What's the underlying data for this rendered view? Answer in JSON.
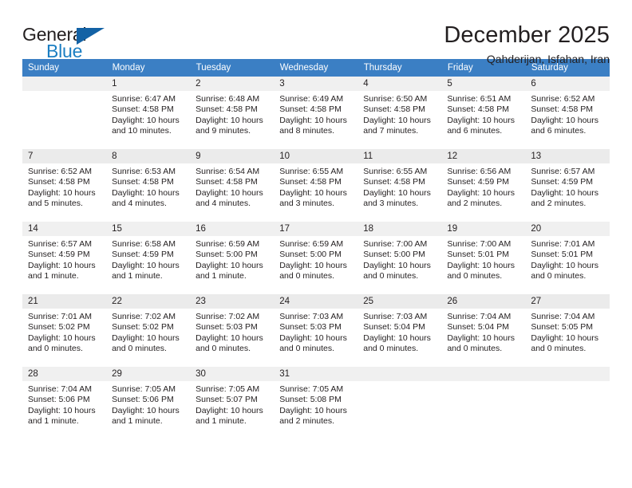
{
  "brand": {
    "general": "General",
    "blue": "Blue",
    "triangle_color": "#1362a5",
    "blue_color": "#1b7ec2"
  },
  "header": {
    "title": "December 2025",
    "subtitle": "Qahderijan, Isfahan, Iran"
  },
  "theme": {
    "header_bg": "#3b7fc4",
    "daynum_bg": "#f0f0f0",
    "row_shade_bg": "#f7f7f7",
    "text": "#231f20"
  },
  "weekday_headers": [
    "Sunday",
    "Monday",
    "Tuesday",
    "Wednesday",
    "Thursday",
    "Friday",
    "Saturday"
  ],
  "weeks": [
    [
      {
        "day": "",
        "sunrise": "",
        "sunset": "",
        "daylight1": "",
        "daylight2": ""
      },
      {
        "day": "1",
        "sunrise": "Sunrise: 6:47 AM",
        "sunset": "Sunset: 4:58 PM",
        "daylight1": "Daylight: 10 hours",
        "daylight2": "and 10 minutes."
      },
      {
        "day": "2",
        "sunrise": "Sunrise: 6:48 AM",
        "sunset": "Sunset: 4:58 PM",
        "daylight1": "Daylight: 10 hours",
        "daylight2": "and 9 minutes."
      },
      {
        "day": "3",
        "sunrise": "Sunrise: 6:49 AM",
        "sunset": "Sunset: 4:58 PM",
        "daylight1": "Daylight: 10 hours",
        "daylight2": "and 8 minutes."
      },
      {
        "day": "4",
        "sunrise": "Sunrise: 6:50 AM",
        "sunset": "Sunset: 4:58 PM",
        "daylight1": "Daylight: 10 hours",
        "daylight2": "and 7 minutes."
      },
      {
        "day": "5",
        "sunrise": "Sunrise: 6:51 AM",
        "sunset": "Sunset: 4:58 PM",
        "daylight1": "Daylight: 10 hours",
        "daylight2": "and 6 minutes."
      },
      {
        "day": "6",
        "sunrise": "Sunrise: 6:52 AM",
        "sunset": "Sunset: 4:58 PM",
        "daylight1": "Daylight: 10 hours",
        "daylight2": "and 6 minutes."
      }
    ],
    [
      {
        "day": "7",
        "sunrise": "Sunrise: 6:52 AM",
        "sunset": "Sunset: 4:58 PM",
        "daylight1": "Daylight: 10 hours",
        "daylight2": "and 5 minutes."
      },
      {
        "day": "8",
        "sunrise": "Sunrise: 6:53 AM",
        "sunset": "Sunset: 4:58 PM",
        "daylight1": "Daylight: 10 hours",
        "daylight2": "and 4 minutes."
      },
      {
        "day": "9",
        "sunrise": "Sunrise: 6:54 AM",
        "sunset": "Sunset: 4:58 PM",
        "daylight1": "Daylight: 10 hours",
        "daylight2": "and 4 minutes."
      },
      {
        "day": "10",
        "sunrise": "Sunrise: 6:55 AM",
        "sunset": "Sunset: 4:58 PM",
        "daylight1": "Daylight: 10 hours",
        "daylight2": "and 3 minutes."
      },
      {
        "day": "11",
        "sunrise": "Sunrise: 6:55 AM",
        "sunset": "Sunset: 4:58 PM",
        "daylight1": "Daylight: 10 hours",
        "daylight2": "and 3 minutes."
      },
      {
        "day": "12",
        "sunrise": "Sunrise: 6:56 AM",
        "sunset": "Sunset: 4:59 PM",
        "daylight1": "Daylight: 10 hours",
        "daylight2": "and 2 minutes."
      },
      {
        "day": "13",
        "sunrise": "Sunrise: 6:57 AM",
        "sunset": "Sunset: 4:59 PM",
        "daylight1": "Daylight: 10 hours",
        "daylight2": "and 2 minutes."
      }
    ],
    [
      {
        "day": "14",
        "sunrise": "Sunrise: 6:57 AM",
        "sunset": "Sunset: 4:59 PM",
        "daylight1": "Daylight: 10 hours",
        "daylight2": "and 1 minute."
      },
      {
        "day": "15",
        "sunrise": "Sunrise: 6:58 AM",
        "sunset": "Sunset: 4:59 PM",
        "daylight1": "Daylight: 10 hours",
        "daylight2": "and 1 minute."
      },
      {
        "day": "16",
        "sunrise": "Sunrise: 6:59 AM",
        "sunset": "Sunset: 5:00 PM",
        "daylight1": "Daylight: 10 hours",
        "daylight2": "and 1 minute."
      },
      {
        "day": "17",
        "sunrise": "Sunrise: 6:59 AM",
        "sunset": "Sunset: 5:00 PM",
        "daylight1": "Daylight: 10 hours",
        "daylight2": "and 0 minutes."
      },
      {
        "day": "18",
        "sunrise": "Sunrise: 7:00 AM",
        "sunset": "Sunset: 5:00 PM",
        "daylight1": "Daylight: 10 hours",
        "daylight2": "and 0 minutes."
      },
      {
        "day": "19",
        "sunrise": "Sunrise: 7:00 AM",
        "sunset": "Sunset: 5:01 PM",
        "daylight1": "Daylight: 10 hours",
        "daylight2": "and 0 minutes."
      },
      {
        "day": "20",
        "sunrise": "Sunrise: 7:01 AM",
        "sunset": "Sunset: 5:01 PM",
        "daylight1": "Daylight: 10 hours",
        "daylight2": "and 0 minutes."
      }
    ],
    [
      {
        "day": "21",
        "sunrise": "Sunrise: 7:01 AM",
        "sunset": "Sunset: 5:02 PM",
        "daylight1": "Daylight: 10 hours",
        "daylight2": "and 0 minutes."
      },
      {
        "day": "22",
        "sunrise": "Sunrise: 7:02 AM",
        "sunset": "Sunset: 5:02 PM",
        "daylight1": "Daylight: 10 hours",
        "daylight2": "and 0 minutes."
      },
      {
        "day": "23",
        "sunrise": "Sunrise: 7:02 AM",
        "sunset": "Sunset: 5:03 PM",
        "daylight1": "Daylight: 10 hours",
        "daylight2": "and 0 minutes."
      },
      {
        "day": "24",
        "sunrise": "Sunrise: 7:03 AM",
        "sunset": "Sunset: 5:03 PM",
        "daylight1": "Daylight: 10 hours",
        "daylight2": "and 0 minutes."
      },
      {
        "day": "25",
        "sunrise": "Sunrise: 7:03 AM",
        "sunset": "Sunset: 5:04 PM",
        "daylight1": "Daylight: 10 hours",
        "daylight2": "and 0 minutes."
      },
      {
        "day": "26",
        "sunrise": "Sunrise: 7:04 AM",
        "sunset": "Sunset: 5:04 PM",
        "daylight1": "Daylight: 10 hours",
        "daylight2": "and 0 minutes."
      },
      {
        "day": "27",
        "sunrise": "Sunrise: 7:04 AM",
        "sunset": "Sunset: 5:05 PM",
        "daylight1": "Daylight: 10 hours",
        "daylight2": "and 0 minutes."
      }
    ],
    [
      {
        "day": "28",
        "sunrise": "Sunrise: 7:04 AM",
        "sunset": "Sunset: 5:06 PM",
        "daylight1": "Daylight: 10 hours",
        "daylight2": "and 1 minute."
      },
      {
        "day": "29",
        "sunrise": "Sunrise: 7:05 AM",
        "sunset": "Sunset: 5:06 PM",
        "daylight1": "Daylight: 10 hours",
        "daylight2": "and 1 minute."
      },
      {
        "day": "30",
        "sunrise": "Sunrise: 7:05 AM",
        "sunset": "Sunset: 5:07 PM",
        "daylight1": "Daylight: 10 hours",
        "daylight2": "and 1 minute."
      },
      {
        "day": "31",
        "sunrise": "Sunrise: 7:05 AM",
        "sunset": "Sunset: 5:08 PM",
        "daylight1": "Daylight: 10 hours",
        "daylight2": "and 2 minutes."
      },
      {
        "day": "",
        "sunrise": "",
        "sunset": "",
        "daylight1": "",
        "daylight2": ""
      },
      {
        "day": "",
        "sunrise": "",
        "sunset": "",
        "daylight1": "",
        "daylight2": ""
      },
      {
        "day": "",
        "sunrise": "",
        "sunset": "",
        "daylight1": "",
        "daylight2": ""
      }
    ]
  ]
}
